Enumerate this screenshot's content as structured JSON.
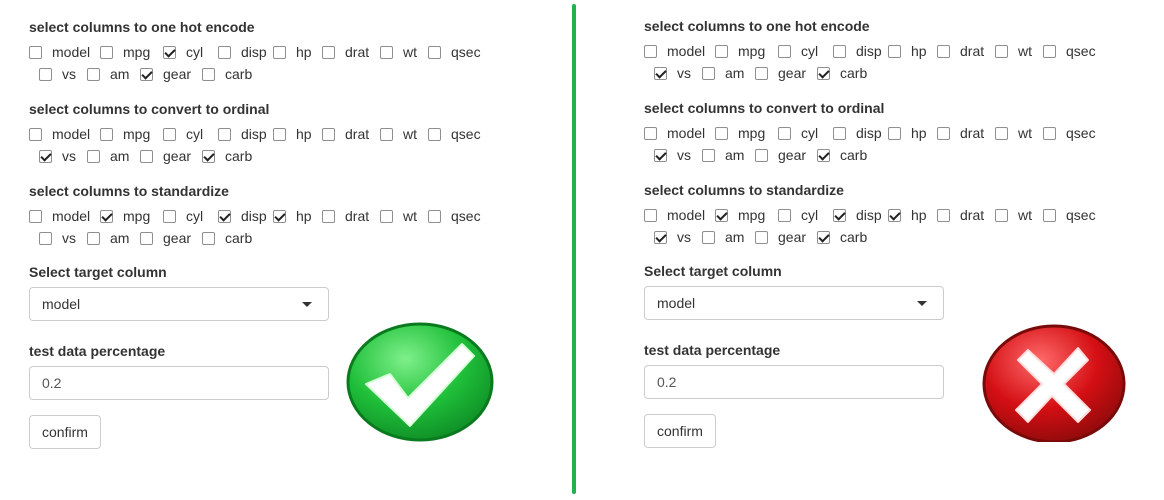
{
  "colors": {
    "divider": "#22b14c",
    "check_green": "#1fbf3a",
    "cross_red": "#d40f14"
  },
  "left": {
    "one_hot": {
      "label": "select columns to one hot encode",
      "row1": [
        {
          "label": "model",
          "checked": false
        },
        {
          "label": "mpg",
          "checked": false
        },
        {
          "label": "cyl",
          "checked": true
        },
        {
          "label": "disp",
          "checked": false
        },
        {
          "label": "hp",
          "checked": false
        },
        {
          "label": "drat",
          "checked": false
        },
        {
          "label": "wt",
          "checked": false
        },
        {
          "label": "qsec",
          "checked": false
        }
      ],
      "row2": [
        {
          "label": "vs",
          "checked": false
        },
        {
          "label": "am",
          "checked": false
        },
        {
          "label": "gear",
          "checked": true
        },
        {
          "label": "carb",
          "checked": false
        }
      ]
    },
    "ordinal": {
      "label": "select columns to convert to ordinal",
      "row1": [
        {
          "label": "model",
          "checked": false
        },
        {
          "label": "mpg",
          "checked": false
        },
        {
          "label": "cyl",
          "checked": false
        },
        {
          "label": "disp",
          "checked": false
        },
        {
          "label": "hp",
          "checked": false
        },
        {
          "label": "drat",
          "checked": false
        },
        {
          "label": "wt",
          "checked": false
        },
        {
          "label": "qsec",
          "checked": false
        }
      ],
      "row2": [
        {
          "label": "vs",
          "checked": true
        },
        {
          "label": "am",
          "checked": false
        },
        {
          "label": "gear",
          "checked": false
        },
        {
          "label": "carb",
          "checked": true
        }
      ]
    },
    "standardize": {
      "label": "select columns to standardize",
      "row1": [
        {
          "label": "model",
          "checked": false
        },
        {
          "label": "mpg",
          "checked": true
        },
        {
          "label": "cyl",
          "checked": false
        },
        {
          "label": "disp",
          "checked": true
        },
        {
          "label": "hp",
          "checked": true
        },
        {
          "label": "drat",
          "checked": false
        },
        {
          "label": "wt",
          "checked": false
        },
        {
          "label": "qsec",
          "checked": false
        }
      ],
      "row2": [
        {
          "label": "vs",
          "checked": false
        },
        {
          "label": "am",
          "checked": false
        },
        {
          "label": "gear",
          "checked": false
        },
        {
          "label": "carb",
          "checked": false
        }
      ]
    },
    "target": {
      "label": "Select target column",
      "value": "model"
    },
    "test": {
      "label": "test data percentage",
      "value": "0.2"
    },
    "confirm_label": "confirm",
    "badge": "check-icon"
  },
  "right": {
    "one_hot": {
      "label": "select columns to one hot encode",
      "row1": [
        {
          "label": "model",
          "checked": false
        },
        {
          "label": "mpg",
          "checked": false
        },
        {
          "label": "cyl",
          "checked": false
        },
        {
          "label": "disp",
          "checked": false
        },
        {
          "label": "hp",
          "checked": false
        },
        {
          "label": "drat",
          "checked": false
        },
        {
          "label": "wt",
          "checked": false
        },
        {
          "label": "qsec",
          "checked": false
        }
      ],
      "row2": [
        {
          "label": "vs",
          "checked": true
        },
        {
          "label": "am",
          "checked": false
        },
        {
          "label": "gear",
          "checked": false
        },
        {
          "label": "carb",
          "checked": true
        }
      ]
    },
    "ordinal": {
      "label": "select columns to convert to ordinal",
      "row1": [
        {
          "label": "model",
          "checked": false
        },
        {
          "label": "mpg",
          "checked": false
        },
        {
          "label": "cyl",
          "checked": false
        },
        {
          "label": "disp",
          "checked": false
        },
        {
          "label": "hp",
          "checked": false
        },
        {
          "label": "drat",
          "checked": false
        },
        {
          "label": "wt",
          "checked": false
        },
        {
          "label": "qsec",
          "checked": false
        }
      ],
      "row2": [
        {
          "label": "vs",
          "checked": true
        },
        {
          "label": "am",
          "checked": false
        },
        {
          "label": "gear",
          "checked": false
        },
        {
          "label": "carb",
          "checked": true
        }
      ]
    },
    "standardize": {
      "label": "select columns to standardize",
      "row1": [
        {
          "label": "model",
          "checked": false
        },
        {
          "label": "mpg",
          "checked": true
        },
        {
          "label": "cyl",
          "checked": false
        },
        {
          "label": "disp",
          "checked": true
        },
        {
          "label": "hp",
          "checked": true
        },
        {
          "label": "drat",
          "checked": false
        },
        {
          "label": "wt",
          "checked": false
        },
        {
          "label": "qsec",
          "checked": false
        }
      ],
      "row2": [
        {
          "label": "vs",
          "checked": true
        },
        {
          "label": "am",
          "checked": false
        },
        {
          "label": "gear",
          "checked": false
        },
        {
          "label": "carb",
          "checked": true
        }
      ]
    },
    "target": {
      "label": "Select target column",
      "value": "model"
    },
    "test": {
      "label": "test data percentage",
      "value": "0.2"
    },
    "confirm_label": "confirm",
    "badge": "cross-icon"
  }
}
